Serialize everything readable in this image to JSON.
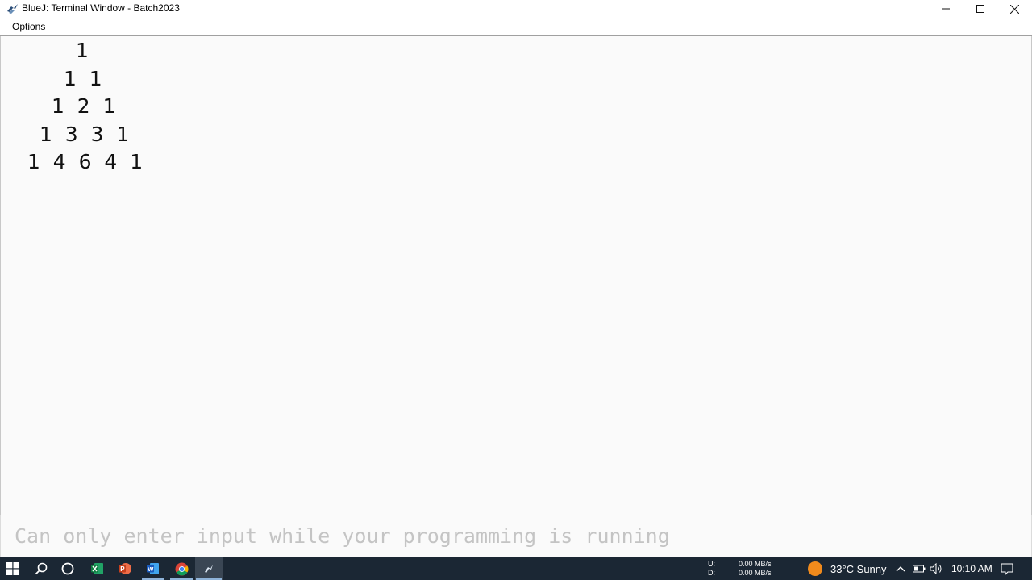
{
  "window": {
    "title": "BlueJ: Terminal Window - Batch2023",
    "app_icon": "bluej-bird-icon"
  },
  "menu": {
    "items": [
      {
        "label": "Options"
      }
    ]
  },
  "output": {
    "lines": [
      "1",
      "1  1",
      "1  2  1",
      "1  3  3  1",
      "1  4  6  4  1"
    ]
  },
  "input": {
    "placeholder": "Can only enter input while your programming is running"
  },
  "taskbar": {
    "apps": [
      "windows-start-icon",
      "search-icon",
      "cortana-icon",
      "excel-icon",
      "powerpoint-icon",
      "word-icon",
      "chrome-icon",
      "bluej-icon"
    ],
    "network": {
      "upload_label": "U:",
      "upload_value": "0.00 MB/s",
      "download_label": "D:",
      "download_value": "0.00 MB/s"
    },
    "weather": "33°C  Sunny",
    "clock": "10:10 AM"
  },
  "colors": {
    "taskbar_bg": "#1b2734",
    "output_bg": "#fafafa",
    "placeholder": "#c4c4c4",
    "weather_sun": "#f08a1c"
  }
}
